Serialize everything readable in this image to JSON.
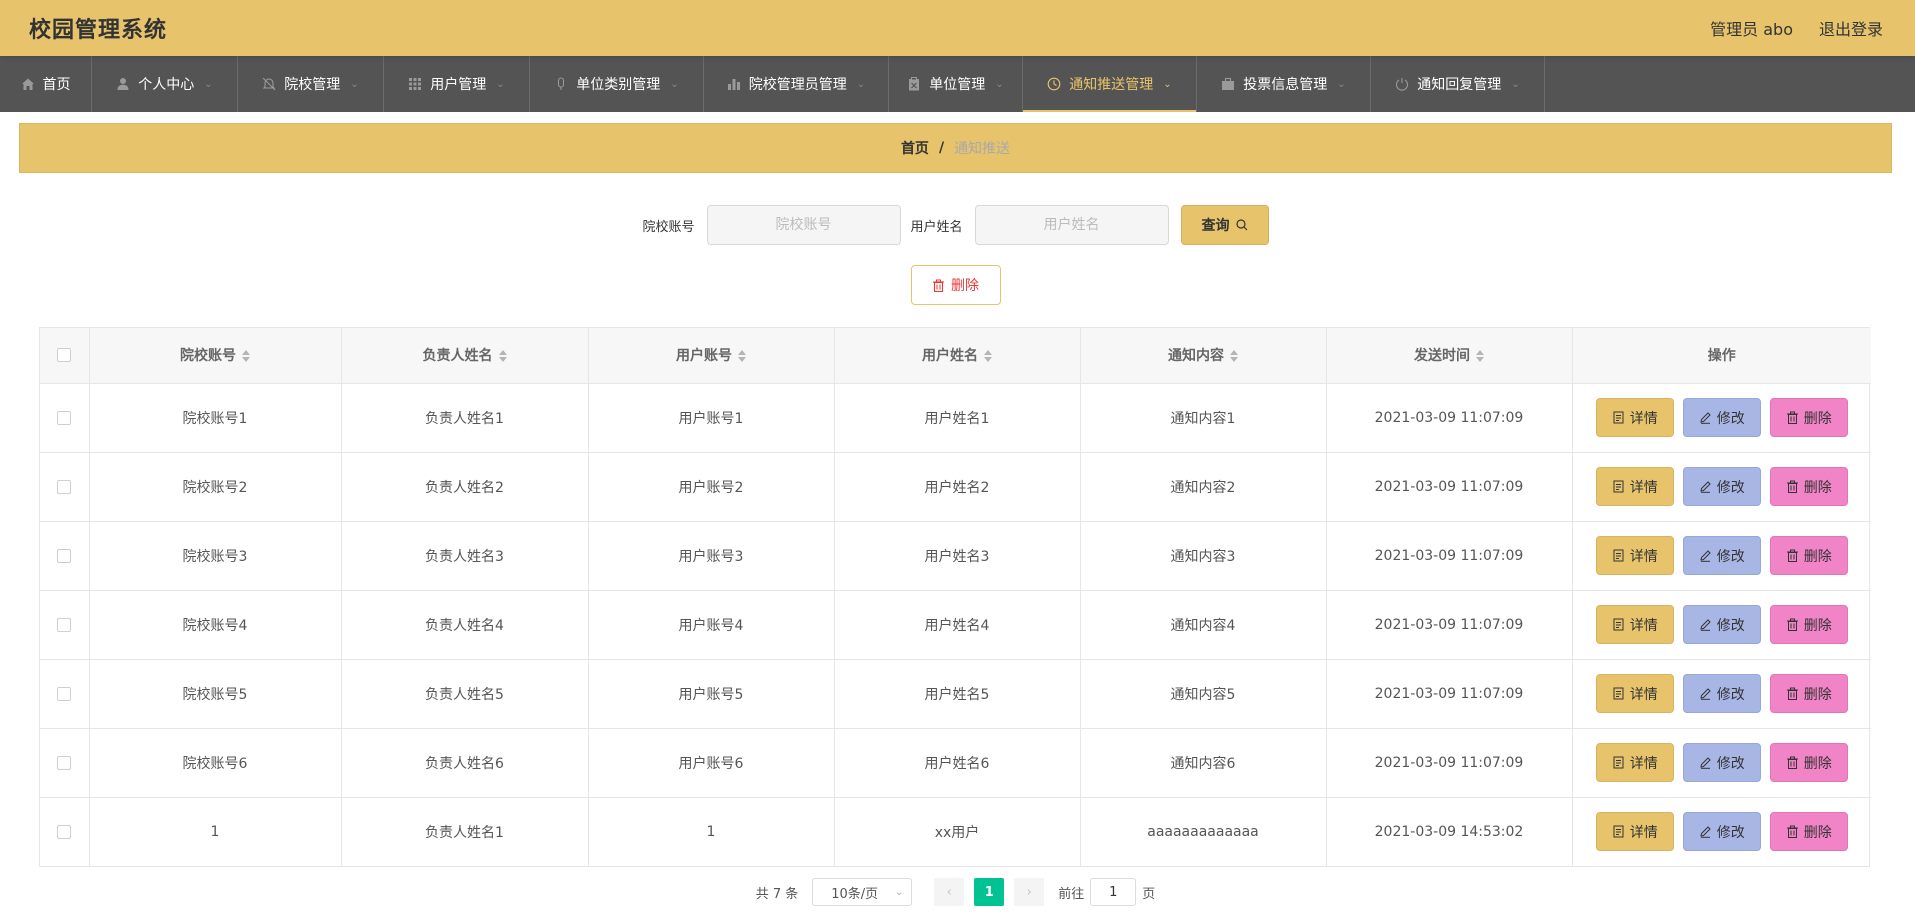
{
  "header": {
    "title": "校园管理系统",
    "user_label": "管理员 abo",
    "logout_label": "退出登录"
  },
  "nav": {
    "items": [
      {
        "label": "首页",
        "icon": "home-icon",
        "has_dropdown": false
      },
      {
        "label": "个人中心",
        "icon": "user-icon",
        "has_dropdown": true
      },
      {
        "label": "院校管理",
        "icon": "bell-off-icon",
        "has_dropdown": true
      },
      {
        "label": "用户管理",
        "icon": "grid-icon",
        "has_dropdown": true
      },
      {
        "label": "单位类别管理",
        "icon": "mic-icon",
        "has_dropdown": true
      },
      {
        "label": "院校管理员管理",
        "icon": "bar-chart-icon",
        "has_dropdown": true
      },
      {
        "label": "单位管理",
        "icon": "clipboard-icon",
        "has_dropdown": true
      },
      {
        "label": "通知推送管理",
        "icon": "clock-icon",
        "has_dropdown": true,
        "active": true
      },
      {
        "label": "投票信息管理",
        "icon": "briefcase-icon",
        "has_dropdown": true
      },
      {
        "label": "通知回复管理",
        "icon": "power-icon",
        "has_dropdown": true
      }
    ]
  },
  "breadcrumb": {
    "home": "首页",
    "separator": "/",
    "current": "通知推送"
  },
  "search": {
    "school_label": "院校账号",
    "school_placeholder": "院校账号",
    "username_label": "用户姓名",
    "username_placeholder": "用户姓名",
    "query_label": "查询"
  },
  "bulk_delete_label": "删除",
  "table": {
    "columns": [
      "院校账号",
      "负责人姓名",
      "用户账号",
      "用户姓名",
      "通知内容",
      "发送时间",
      "操作"
    ],
    "rows": [
      [
        "院校账号1",
        "负责人姓名1",
        "用户账号1",
        "用户姓名1",
        "通知内容1",
        "2021-03-09 11:07:09"
      ],
      [
        "院校账号2",
        "负责人姓名2",
        "用户账号2",
        "用户姓名2",
        "通知内容2",
        "2021-03-09 11:07:09"
      ],
      [
        "院校账号3",
        "负责人姓名3",
        "用户账号3",
        "用户姓名3",
        "通知内容3",
        "2021-03-09 11:07:09"
      ],
      [
        "院校账号4",
        "负责人姓名4",
        "用户账号4",
        "用户姓名4",
        "通知内容4",
        "2021-03-09 11:07:09"
      ],
      [
        "院校账号5",
        "负责人姓名5",
        "用户账号5",
        "用户姓名5",
        "通知内容5",
        "2021-03-09 11:07:09"
      ],
      [
        "院校账号6",
        "负责人姓名6",
        "用户账号6",
        "用户姓名6",
        "通知内容6",
        "2021-03-09 11:07:09"
      ],
      [
        "1",
        "负责人姓名1",
        "1",
        "xx用户",
        "aaaaaaaaaaaaa",
        "2021-03-09 14:53:02"
      ]
    ],
    "actions": {
      "detail": "详情",
      "edit": "修改",
      "delete": "删除"
    }
  },
  "pagination": {
    "total_label": "共 7 条",
    "page_size": "10条/页",
    "current_page": "1",
    "goto_prefix": "前往",
    "goto_value": "1",
    "goto_suffix": "页"
  },
  "colors": {
    "accent": "#e7c46c",
    "nav_bg": "#545454",
    "page_active": "#00c292",
    "edit_btn": "#a8b6e6",
    "delete_btn": "#f184c7"
  }
}
